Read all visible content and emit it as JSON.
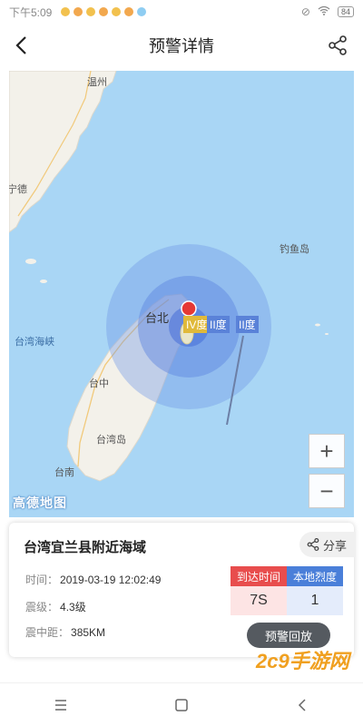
{
  "status_bar": {
    "time": "下午5:09",
    "battery": "84"
  },
  "header": {
    "title": "预警详情"
  },
  "map": {
    "labels": {
      "wenzhou": "温州",
      "ningde": "宁德",
      "diaoyudao": "钓鱼岛",
      "taipei": "台北",
      "taiwan_strait": "台湾海峡",
      "taichung": "台中",
      "taiwan_island": "台湾岛",
      "tainan": "台南"
    },
    "intensity_labels": {
      "iv": "IV度",
      "iii": "II度",
      "ii": "II度"
    },
    "logo": "高德地图",
    "zoom_in": "+",
    "zoom_out": "−"
  },
  "info": {
    "title": "台湾宜兰县附近海域",
    "share": "分享",
    "time_label": "时间：",
    "time_value": "2019-03-19 12:02:49",
    "magnitude_label": "震级：",
    "magnitude_value": "4.3级",
    "distance_label": "震中距：",
    "distance_value": "385KM",
    "arrival_header": "到达时间",
    "intensity_header": "本地烈度",
    "arrival_value": "7S",
    "intensity_value": "1",
    "replay_button": "预警回放"
  },
  "watermark": "2c9手游网",
  "colors": {
    "sea": "#a9d6f5",
    "land": "#f3f1ea",
    "arrival_header": "#e84d4d",
    "intensity_header": "#4a7fd9",
    "arrival_cell": "#fde4e4",
    "intensity_cell": "#e4ecfb"
  }
}
